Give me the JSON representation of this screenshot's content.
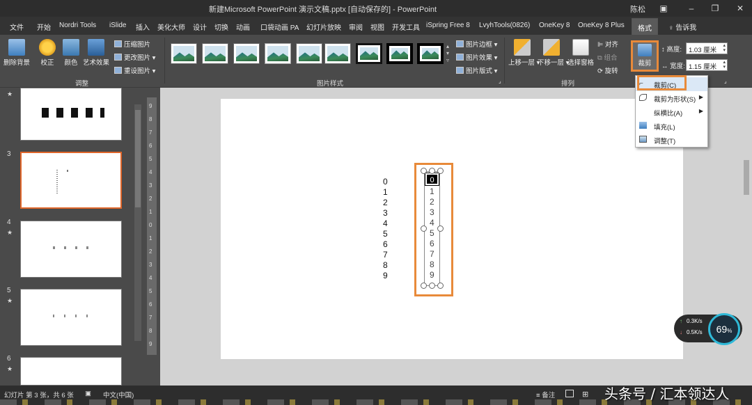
{
  "window": {
    "title": "新建Microsoft PowerPoint 演示文稿.pptx [自动保存的]  -  PowerPoint",
    "user": "陈松",
    "ribbon_opts_icon": "ribbon-display-icon",
    "min_icon": "minimize-icon",
    "max_icon": "maximize-icon",
    "close_icon": "close-icon"
  },
  "menu": {
    "items": [
      "文件",
      "开始",
      "Nordri Tools",
      "iSlide",
      "插入",
      "美化大师",
      "设计",
      "切换",
      "动画",
      "口袋动画 PA",
      "幻灯片放映",
      "审阅",
      "视图",
      "开发工具",
      "iSpring Free 8",
      "LvyhTools(0826)",
      "OneKey 8",
      "OneKey 8 Plus",
      "格式"
    ],
    "tell_me": "告诉我"
  },
  "ribbon": {
    "remove_bg": "删除背景",
    "correct": "校正",
    "color": "颜色",
    "art_effects": "艺术效果",
    "compress": "压缩图片",
    "change": "更改图片",
    "reset": "重设图片",
    "adjust_group": "调整",
    "styles_group": "图片样式",
    "border": "图片边框",
    "effects": "图片效果",
    "layout": "图片版式",
    "bring_forward": "上移一层",
    "send_backward": "下移一层",
    "selection_pane": "选择窗格",
    "align": "对齐",
    "group": "组合",
    "rotate": "旋转",
    "arrange_group": "排列",
    "crop": "裁剪",
    "height_label": "高度:",
    "height_value": "1.03 厘米",
    "width_label": "宽度:",
    "width_value": "1.15 厘米"
  },
  "crop_menu": {
    "items": [
      {
        "label": "裁剪(C)",
        "icon": "crop-icon"
      },
      {
        "label": "裁剪为形状(S)",
        "icon": "shape-crop-icon"
      },
      {
        "label": "纵横比(A)",
        "icon": ""
      },
      {
        "label": "填充(L)",
        "icon": "fill-icon"
      },
      {
        "label": "调整(T)",
        "icon": "fit-icon"
      }
    ]
  },
  "slides": [
    {
      "num": "3"
    },
    {
      "num": "4"
    },
    {
      "num": "5"
    },
    {
      "num": "6"
    }
  ],
  "slide_content": {
    "left_digits": [
      "0",
      "1",
      "2",
      "3",
      "4",
      "5",
      "6",
      "7",
      "8",
      "9"
    ],
    "right_top_glyph": "0",
    "right_digits": [
      "1",
      "2",
      "3",
      "4",
      "5",
      "6",
      "7",
      "8",
      "9"
    ]
  },
  "ruler_labels": [
    "9",
    "8",
    "7",
    "6",
    "5",
    "4",
    "3",
    "2",
    "1",
    "0",
    "1",
    "2",
    "3",
    "4",
    "5",
    "6",
    "7",
    "8",
    "9"
  ],
  "status": {
    "slide_info": "幻灯片 第 3 张，共 6 张",
    "language": "中文(中国)",
    "notes": "备注"
  },
  "speed": {
    "up": "0.3K/s",
    "down": "0.5K/s",
    "percent": "69"
  },
  "watermark": "头条号 / 汇本领达人"
}
